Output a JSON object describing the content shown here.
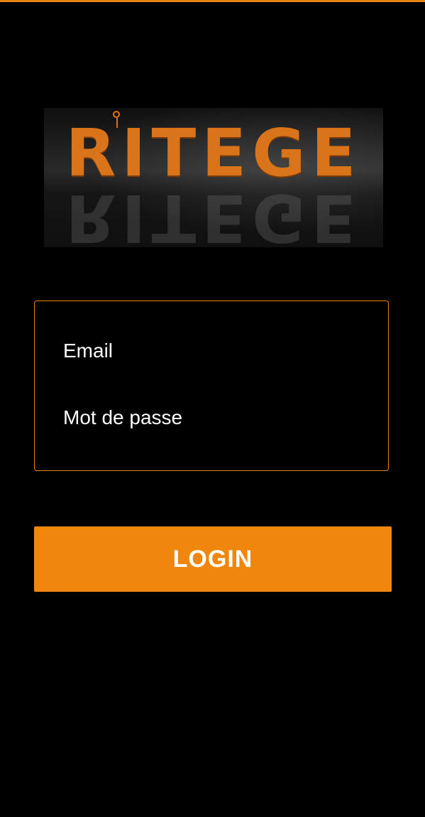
{
  "brand": {
    "logo_text": "RITEGE",
    "accent_color": "#f0870c"
  },
  "login_form": {
    "email_placeholder": "Email",
    "password_placeholder": "Mot de passe",
    "submit_label": "LOGIN"
  }
}
